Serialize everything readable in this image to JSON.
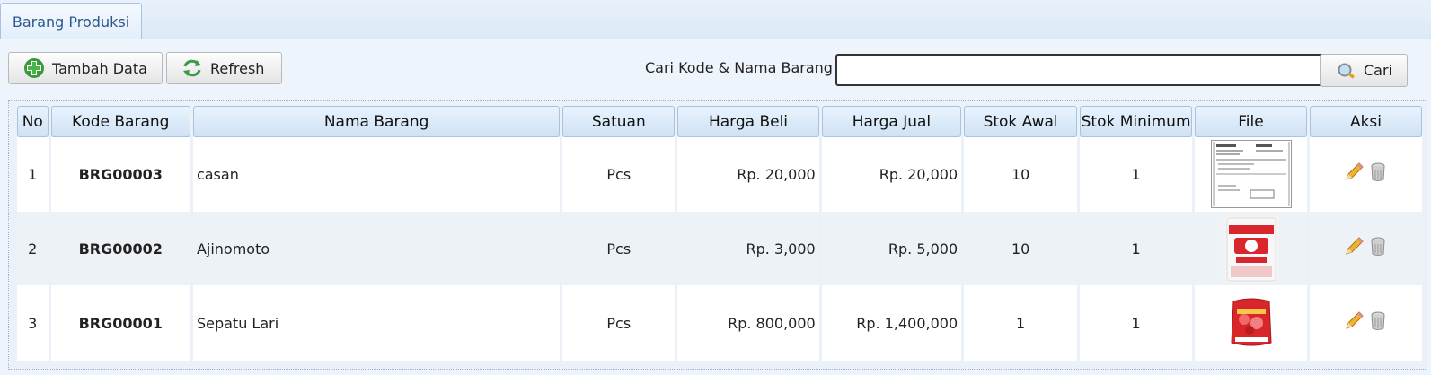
{
  "tab": {
    "label": "Barang Produksi"
  },
  "toolbar": {
    "add_label": "Tambah Data",
    "refresh_label": "Refresh",
    "search_label": "Cari Kode & Nama Barang :",
    "search_value": "",
    "search_button_label": "Cari"
  },
  "table": {
    "headers": [
      "No",
      "Kode Barang",
      "Nama Barang",
      "Satuan",
      "Harga Beli",
      "Harga Jual",
      "Stok Awal",
      "Stok Minimum",
      "File",
      "Aksi"
    ],
    "rows": [
      {
        "no": "1",
        "kode": "BRG00003",
        "nama": "casan",
        "satuan": "Pcs",
        "harga_beli": "Rp. 20,000",
        "harga_jual": "Rp. 20,000",
        "stok_awal": "10",
        "stok_min": "1",
        "file": "document-thumbnail"
      },
      {
        "no": "2",
        "kode": "BRG00002",
        "nama": "Ajinomoto",
        "satuan": "Pcs",
        "harga_beli": "Rp. 3,000",
        "harga_jual": "Rp. 5,000",
        "stok_awal": "10",
        "stok_min": "1",
        "file": "ajinomoto-package-thumbnail"
      },
      {
        "no": "3",
        "kode": "BRG00001",
        "nama": "Sepatu Lari",
        "satuan": "Pcs",
        "harga_beli": "Rp. 800,000",
        "harga_jual": "Rp. 1,400,000",
        "stok_awal": "1",
        "stok_min": "1",
        "file": "red-product-pack-thumbnail"
      }
    ]
  },
  "colors": {
    "accent": "#2b5a8a",
    "header_bg": "#cfe2f5",
    "tab_bg": "#e3eefa"
  },
  "icons": [
    "add-icon",
    "refresh-icon",
    "search-icon",
    "edit-icon",
    "delete-icon"
  ]
}
